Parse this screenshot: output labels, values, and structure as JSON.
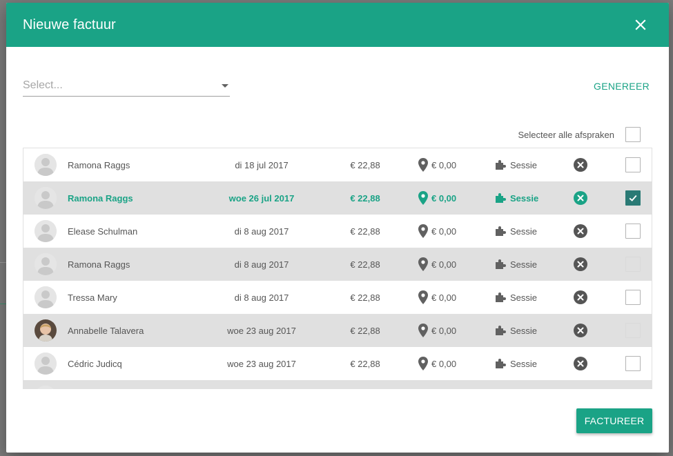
{
  "dialog": {
    "title": "Nieuwe factuur",
    "select_placeholder": "Select...",
    "generate_label": "GENEREER",
    "select_all_label": "Selecteer alle afspraken",
    "submit_label": "FACTUREER"
  },
  "colors": {
    "accent": "#1aa386",
    "row_alt": "#e0e0e0",
    "checkbox_checked": "#2a7a75"
  },
  "rows": [
    {
      "name": "Ramona Raggs",
      "date": "di 18 jul 2017",
      "price": "€ 22,88",
      "location_price": "€ 0,00",
      "type": "Sessie",
      "avatar": "placeholder",
      "selected": false,
      "checked": false,
      "checkbox_state": "empty"
    },
    {
      "name": "Ramona Raggs",
      "date": "woe 26 jul 2017",
      "price": "€ 22,88",
      "location_price": "€ 0,00",
      "type": "Sessie",
      "avatar": "placeholder",
      "selected": true,
      "checked": true,
      "checkbox_state": "checked"
    },
    {
      "name": "Elease Schulman",
      "date": "di 8 aug 2017",
      "price": "€ 22,88",
      "location_price": "€ 0,00",
      "type": "Sessie",
      "avatar": "placeholder",
      "selected": false,
      "checked": false,
      "checkbox_state": "empty"
    },
    {
      "name": "Ramona Raggs",
      "date": "di 8 aug 2017",
      "price": "€ 22,88",
      "location_price": "€ 0,00",
      "type": "Sessie",
      "avatar": "placeholder",
      "selected": false,
      "checked": false,
      "checkbox_state": "disabled"
    },
    {
      "name": "Tressa Mary",
      "date": "di 8 aug 2017",
      "price": "€ 22,88",
      "location_price": "€ 0,00",
      "type": "Sessie",
      "avatar": "placeholder",
      "selected": false,
      "checked": false,
      "checkbox_state": "empty"
    },
    {
      "name": "Annabelle Talavera",
      "date": "woe 23 aug 2017",
      "price": "€ 22,88",
      "location_price": "€ 0,00",
      "type": "Sessie",
      "avatar": "photo",
      "selected": false,
      "checked": false,
      "checkbox_state": "disabled"
    },
    {
      "name": "Cédric Judicq",
      "date": "woe 23 aug 2017",
      "price": "€ 22,88",
      "location_price": "€ 0,00",
      "type": "Sessie",
      "avatar": "placeholder",
      "selected": false,
      "checked": false,
      "checkbox_state": "empty"
    }
  ]
}
